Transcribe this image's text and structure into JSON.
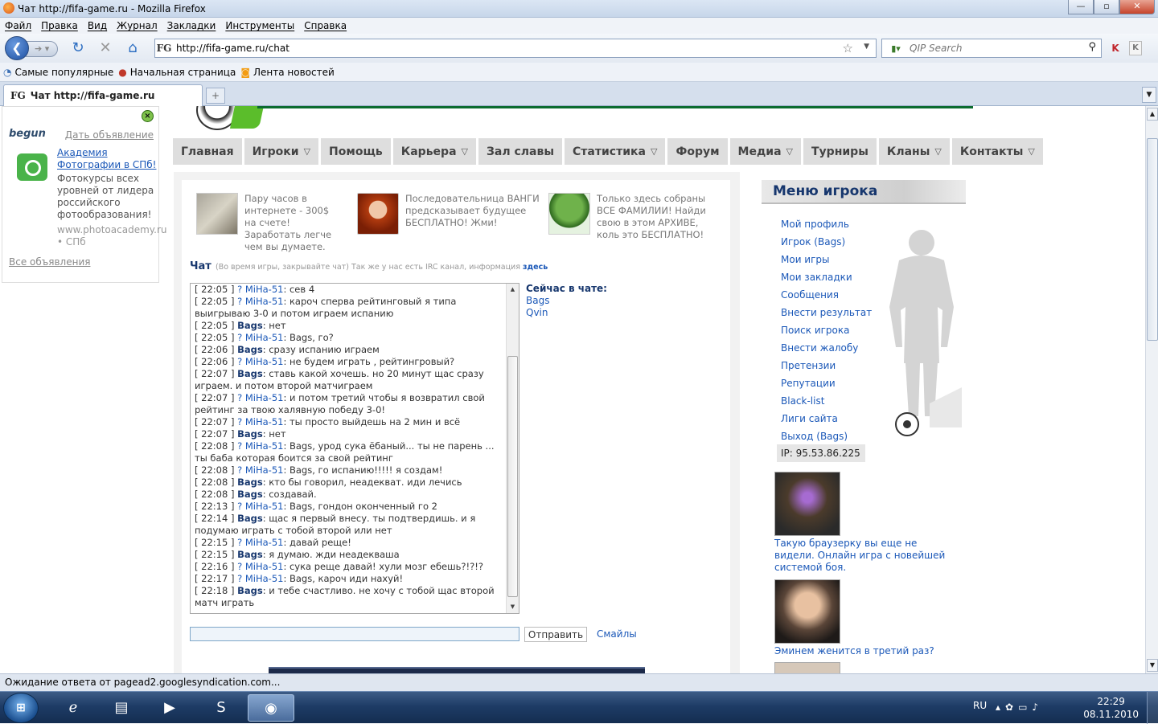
{
  "window": {
    "title": "Чат http://fifa-game.ru - Mozilla Firefox",
    "buttons": {
      "minimize": "—",
      "maximize": "▫",
      "close": "✕"
    }
  },
  "menubar": [
    "Файл",
    "Правка",
    "Вид",
    "Журнал",
    "Закладки",
    "Инструменты",
    "Справка"
  ],
  "navbar": {
    "url": "http://fifa-game.ru/chat",
    "search_placeholder": "QIP Search",
    "favicon_text": "FG"
  },
  "bookmarks": [
    {
      "label": "Самые популярные",
      "icon": "globe-icon"
    },
    {
      "label": "Начальная страница",
      "icon": "firefox-icon"
    },
    {
      "label": "Лента новостей",
      "icon": "rss-icon"
    }
  ],
  "tabs": [
    {
      "label": "Чат http://fifa-game.ru",
      "active": true
    }
  ],
  "ads": {
    "brand": "begun",
    "give_ad": "Дать объявление",
    "title": "Академия Фотографии в СПб!",
    "description": "Фотокурсы всех уровней от лидера российского фотообразования!",
    "url": "www.photoacademy.ru • СПб",
    "all_ads": "Все объявления"
  },
  "site_nav": [
    {
      "label": "Главная",
      "dropdown": false
    },
    {
      "label": "Игроки",
      "dropdown": true
    },
    {
      "label": "Помощь",
      "dropdown": false
    },
    {
      "label": "Карьера",
      "dropdown": true
    },
    {
      "label": "Зал славы",
      "dropdown": false
    },
    {
      "label": "Статистика",
      "dropdown": true
    },
    {
      "label": "Форум",
      "dropdown": false
    },
    {
      "label": "Медиа",
      "dropdown": true
    },
    {
      "label": "Турниры",
      "dropdown": false
    },
    {
      "label": "Кланы",
      "dropdown": true
    },
    {
      "label": "Контакты",
      "dropdown": true
    }
  ],
  "promos": [
    "Пару часов в интернете - 300$ на счете! Заработать легче чем вы думаете.",
    "Последовательница ВАНГИ предсказывает будущее БЕСПЛАТНО! Жми!",
    "Только здесь собраны ВСЕ ФАМИЛИИ! Найди свою в этом АРХИВЕ, коль это БЕСПЛАТНО!"
  ],
  "chat": {
    "label": "Чат",
    "note": "(Во время игры, закрывайте чат) Так же у нас есть IRC канал, информация",
    "note_link": "здесь",
    "messages": [
      {
        "time": "[ 22:05 ]",
        "user": "? MiHa-51",
        "type": "m",
        "text": ": сев 4"
      },
      {
        "time": "[ 22:05 ]",
        "user": "? MiHa-51",
        "type": "m",
        "text": ": кароч сперва рейтинговый я типа выигрываю 3-0 и потом играем испанию"
      },
      {
        "time": "[ 22:05 ]",
        "user": "Bags",
        "type": "b",
        "text": ": нет"
      },
      {
        "time": "[ 22:05 ]",
        "user": "? MiHa-51",
        "type": "m",
        "text": ": Bags, го?"
      },
      {
        "time": "[ 22:06 ]",
        "user": "Bags",
        "type": "b",
        "text": ": сразу испанию играем"
      },
      {
        "time": "[ 22:06 ]",
        "user": "? MiHa-51",
        "type": "m",
        "text": ": не будем играть , рейтингровый?"
      },
      {
        "time": "[ 22:07 ]",
        "user": "Bags",
        "type": "b",
        "text": ": ставь какой хочешь. но 20 минут щас сразу играем. и потом второй матчиграем"
      },
      {
        "time": "[ 22:07 ]",
        "user": "? MiHa-51",
        "type": "m",
        "text": ": и потом третий чтобы я возвратил свой рейтинг за твою халявную победу 3-0!"
      },
      {
        "time": "[ 22:07 ]",
        "user": "? MiHa-51",
        "type": "m",
        "text": ": ты просто выйдешь на 2 мин и всё"
      },
      {
        "time": "[ 22:07 ]",
        "user": "Bags",
        "type": "b",
        "text": ": нет"
      },
      {
        "time": "[ 22:08 ]",
        "user": "? MiHa-51",
        "type": "m",
        "text": ": Bags, урод сука ёбаный... ты не парень ... ты баба которая боится за свой рейтинг"
      },
      {
        "time": "[ 22:08 ]",
        "user": "? MiHa-51",
        "type": "m",
        "text": ": Bags, го испанию!!!!! я создам!"
      },
      {
        "time": "[ 22:08 ]",
        "user": "Bags",
        "type": "b",
        "text": ": кто бы говорил, неадекват. иди лечись"
      },
      {
        "time": "[ 22:08 ]",
        "user": "Bags",
        "type": "b",
        "text": ": создавай."
      },
      {
        "time": "[ 22:13 ]",
        "user": "? MiHa-51",
        "type": "m",
        "text": ": Bags, гондон оконченный го 2"
      },
      {
        "time": "[ 22:14 ]",
        "user": "Bags",
        "type": "b",
        "text": ": щас я первый внесу. ты подтвердишь. и я подумаю играть с тобой второй или нет"
      },
      {
        "time": "[ 22:15 ]",
        "user": "? MiHa-51",
        "type": "m",
        "text": ": давай реще!"
      },
      {
        "time": "[ 22:15 ]",
        "user": "Bags",
        "type": "b",
        "text": ": я думаю. жди неадекваша"
      },
      {
        "time": "[ 22:16 ]",
        "user": "? MiHa-51",
        "type": "m",
        "text": ": сука реще давай! хули мозг ебешь?!?!?"
      },
      {
        "time": "[ 22:17 ]",
        "user": "? MiHa-51",
        "type": "m",
        "text": ": Bags, кароч иди нахуй!"
      },
      {
        "time": "[ 22:18 ]",
        "user": "Bags",
        "type": "b",
        "text": ": и тебе счастливо. не хочу с тобой щас второй матч играть"
      }
    ],
    "online_header": "Сейчас в чате:",
    "online_users": [
      "Bags",
      "Qvin"
    ],
    "send_label": "Отправить",
    "smiles_label": "Смайлы"
  },
  "player_menu": {
    "header": "Меню игрока",
    "items": [
      "Мой профиль",
      "Игрок (Bags)",
      "Мои игры",
      "Мои закладки",
      "Сообщения",
      "Внести результат",
      "Поиск игрока",
      "Внести жалобу",
      "Претензии",
      "Репутации",
      "Black-list",
      "Лиги сайта",
      "Выход (Bags)"
    ],
    "ip": "IP: 95.53.86.225"
  },
  "news": [
    "Такую браузерку вы еще не видели. Онлайн игра с новейшей системой боя.",
    "Эминем женится в третий раз?"
  ],
  "status": "Ожидание ответа от pagead2.googlesyndication.com...",
  "taskbar": {
    "lang": "RU",
    "time": "22:29",
    "date": "08.11.2010"
  }
}
